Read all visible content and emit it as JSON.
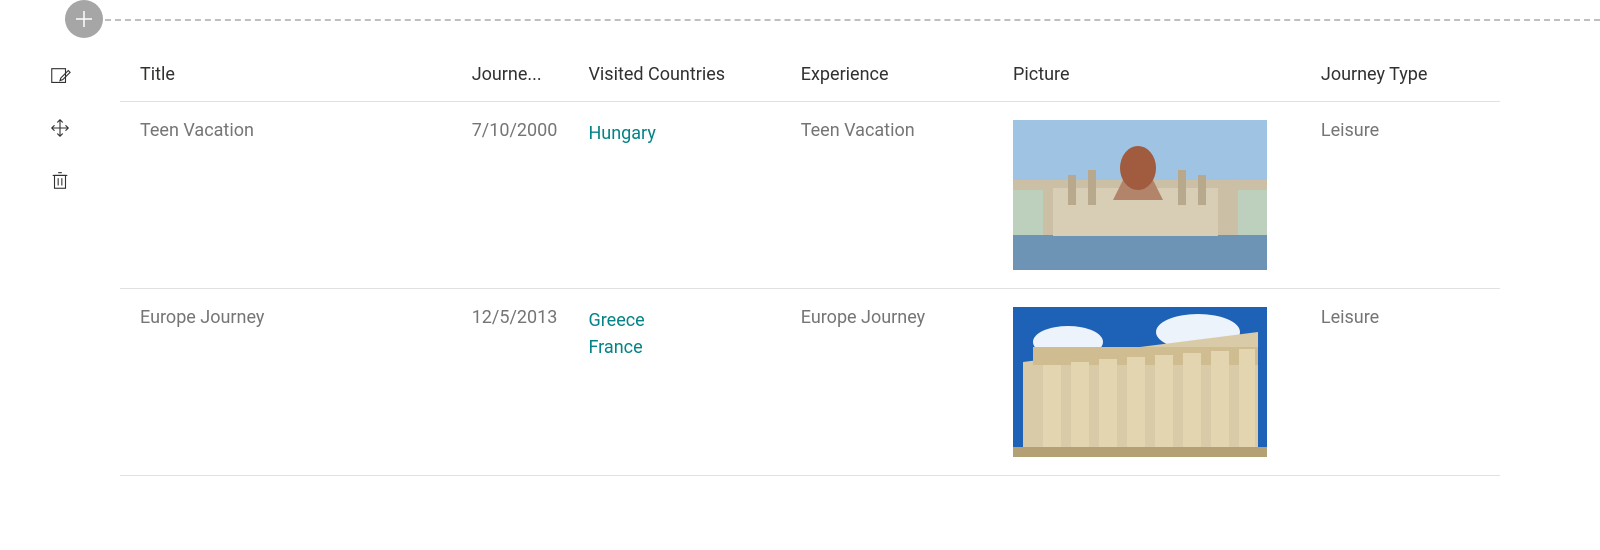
{
  "toolbar": {
    "add_label": "Add",
    "edit_label": "Edit",
    "move_label": "Move",
    "delete_label": "Delete"
  },
  "table": {
    "columns": {
      "title": "Title",
      "date": "Journe...",
      "countries": "Visited Countries",
      "experience": "Experience",
      "picture": "Picture",
      "type": "Journey Type"
    },
    "rows": [
      {
        "title": "Teen Vacation",
        "date": "7/10/2000",
        "countries": [
          "Hungary"
        ],
        "experience": "Teen Vacation",
        "type": "Leisure",
        "picture_alt": "Hungary parliament building"
      },
      {
        "title": "Europe Journey",
        "date": "12/5/2013",
        "countries": [
          "Greece",
          "France"
        ],
        "experience": "Europe Journey",
        "type": "Leisure",
        "picture_alt": "Parthenon in Greece"
      }
    ]
  }
}
